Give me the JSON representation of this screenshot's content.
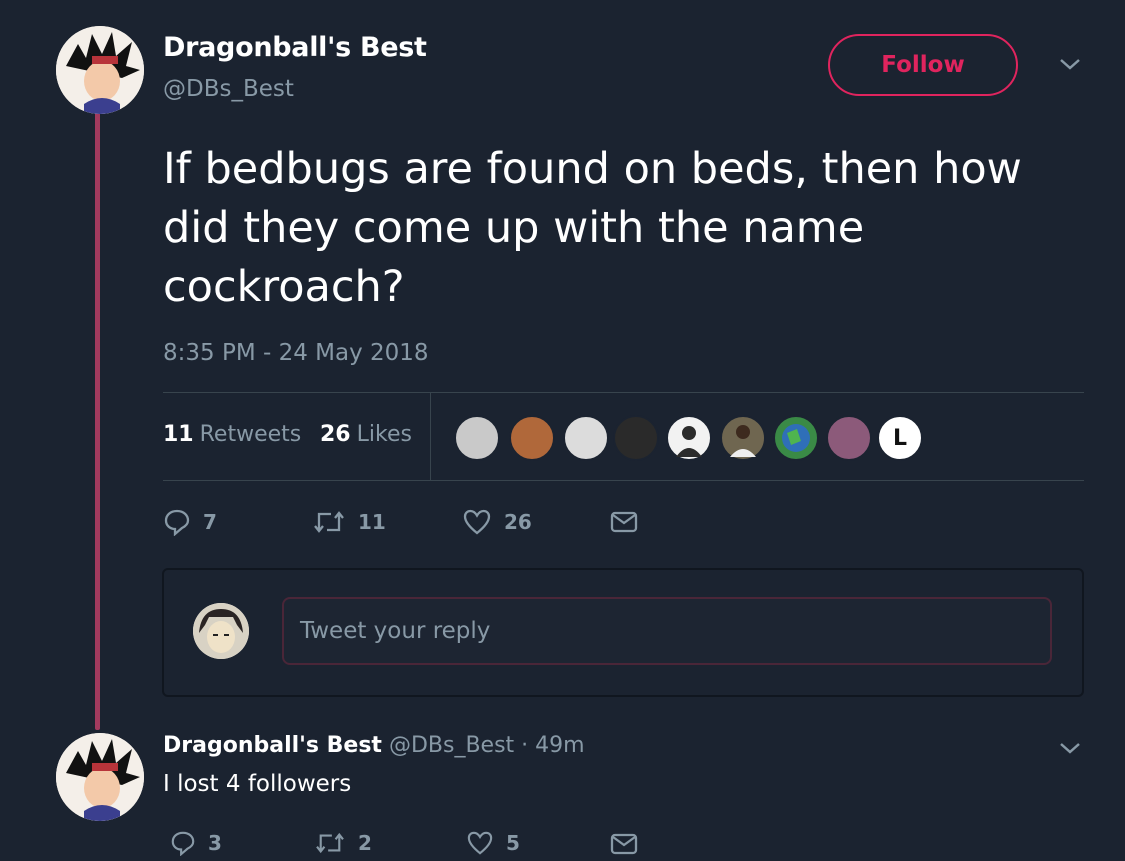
{
  "main_tweet": {
    "display_name": "Dragonball's Best",
    "handle": "@DBs_Best",
    "follow_label": "Follow",
    "text": "If bedbugs are found on beds, then how did they come up with the name cockroach?",
    "timestamp": "8:35 PM - 24 May 2018",
    "retweets_count": "11",
    "retweets_label": "Retweets",
    "likes_count": "26",
    "likes_label": "Likes",
    "actions": {
      "replies": "7",
      "retweets": "11",
      "likes": "26"
    }
  },
  "reply_composer": {
    "placeholder": "Tweet your reply"
  },
  "reply_tweet": {
    "display_name": "Dragonball's Best",
    "handle": "@DBs_Best",
    "time": "· 49m",
    "text": "I lost 4 followers",
    "actions": {
      "replies": "3",
      "retweets": "2",
      "likes": "5"
    }
  },
  "likers": [
    {
      "color": "#c9c9c9"
    },
    {
      "color": "#b0683a"
    },
    {
      "color": "#dcdcdc"
    },
    {
      "color": "#2a2a2a"
    },
    {
      "color": "#f2f2f2"
    },
    {
      "color": "#6f6650"
    },
    {
      "color": "#3a8a46"
    },
    {
      "color": "#8c5a7a"
    },
    {
      "color": "#ffffff",
      "letter": "L"
    }
  ],
  "colors": {
    "background": "#1b2330",
    "accent": "#e0245e",
    "muted": "#8899a6",
    "thread": "#a23a5e"
  }
}
